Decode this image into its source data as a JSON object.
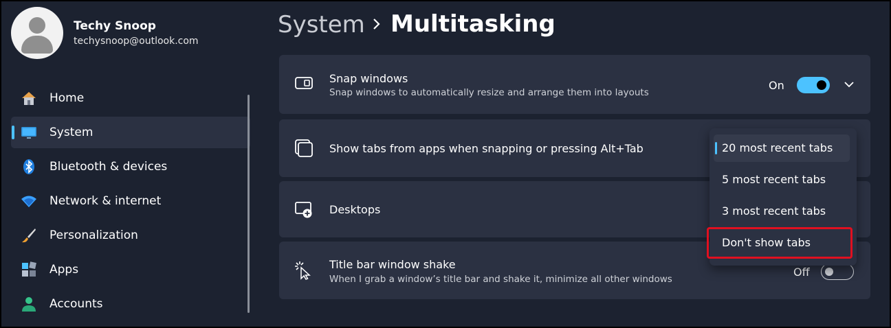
{
  "profile": {
    "name": "Techy Snoop",
    "email": "techysnoop@outlook.com"
  },
  "nav": {
    "items": [
      {
        "label": "Home",
        "icon": "home-icon",
        "active": false
      },
      {
        "label": "System",
        "icon": "system-icon",
        "active": true
      },
      {
        "label": "Bluetooth & devices",
        "icon": "bluetooth-icon",
        "active": false
      },
      {
        "label": "Network & internet",
        "icon": "wifi-icon",
        "active": false
      },
      {
        "label": "Personalization",
        "icon": "brush-icon",
        "active": false
      },
      {
        "label": "Apps",
        "icon": "apps-icon",
        "active": false
      },
      {
        "label": "Accounts",
        "icon": "person-icon",
        "active": false
      }
    ]
  },
  "header": {
    "parent": "System",
    "current": "Multitasking"
  },
  "settings": {
    "snap": {
      "title": "Snap windows",
      "subtitle": "Snap windows to automatically resize and arrange them into layouts",
      "state_label": "On",
      "enabled": true
    },
    "tabs": {
      "title": "Show tabs from apps when snapping or pressing Alt+Tab"
    },
    "desktops": {
      "title": "Desktops"
    },
    "shake": {
      "title": "Title bar window shake",
      "subtitle": "When I grab a window’s title bar and shake it, minimize all other windows",
      "state_label": "Off",
      "enabled": false
    }
  },
  "dropdown": {
    "options": [
      "20 most recent tabs",
      "5 most recent tabs",
      "3 most recent tabs",
      "Don't show tabs"
    ],
    "selected_index": 0,
    "highlighted_index": 3
  },
  "colors": {
    "accent": "#4cc2ff",
    "background": "#1c2230",
    "card": "#2b3142",
    "highlight": "#e01020"
  }
}
